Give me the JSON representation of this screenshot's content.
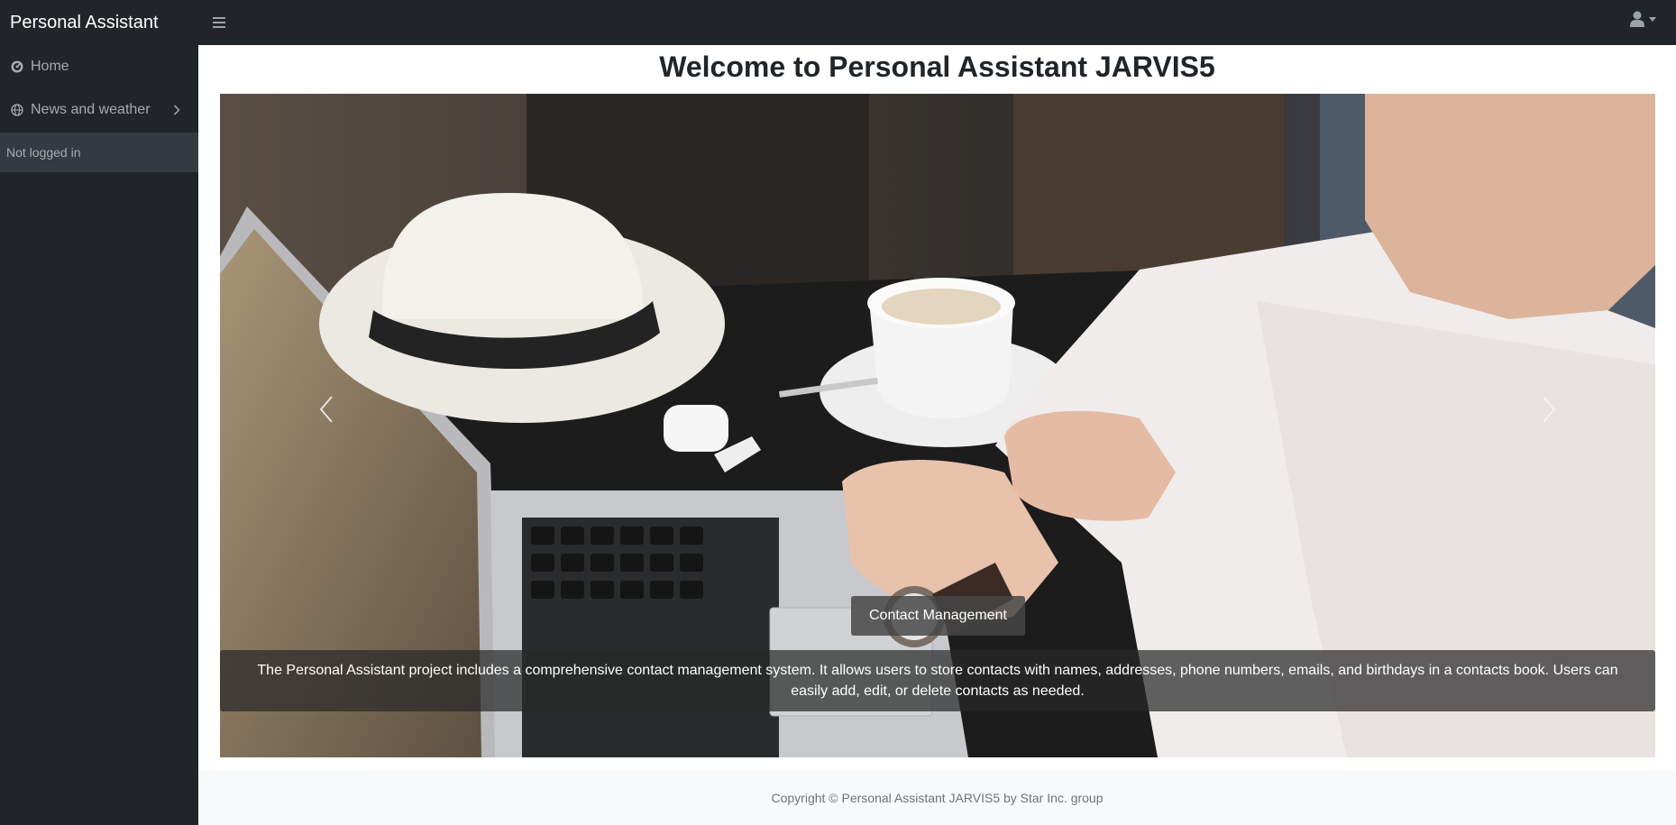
{
  "topbar": {
    "brand": "Personal Assistant",
    "toggle_icon": "menu-icon",
    "user_icon": "user-icon"
  },
  "sidebar": {
    "items": [
      {
        "label": "Home",
        "icon": "dashboard-icon"
      },
      {
        "label": "News and weather",
        "icon": "globe-icon",
        "has_submenu": true
      }
    ],
    "footer": "Not logged in"
  },
  "main": {
    "title": "Welcome to Personal Assistant JARVIS5",
    "carousel": {
      "caption_title": "Contact Management",
      "caption_text": "The Personal Assistant project includes a comprehensive contact management system. It allows users to store contacts with names, addresses, phone numbers, emails, and birthdays in a contacts book. Users can easily add, edit, or delete contacts as needed."
    }
  },
  "footer": {
    "text": "Copyright © Personal Assistant JARVIS5 by Star Inc. group"
  },
  "colors": {
    "topbar_bg": "#212529",
    "sidebar_footer_bg": "#343a40",
    "footer_bg": "#f8f9fa"
  }
}
